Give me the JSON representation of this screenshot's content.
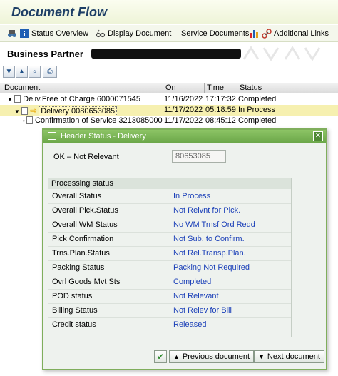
{
  "window": {
    "title": "Document Flow"
  },
  "toolbar": {
    "status_overview": "Status Overview",
    "display_document": "Display Document",
    "service_documents": "Service Documents",
    "additional_links": "Additional Links"
  },
  "business_partner": {
    "label": "Business Partner"
  },
  "grid": {
    "headers": {
      "document": "Document",
      "on": "On",
      "time": "Time",
      "status": "Status"
    },
    "rows": [
      {
        "document": "Deliv.Free of Charge 6000071545",
        "on": "11/16/2022",
        "time": "17:17:32",
        "status": "Completed"
      },
      {
        "document": "Delivery 0080653085",
        "on": "11/17/2022",
        "time": "05:18:59",
        "status": "In Process"
      },
      {
        "document": "Confirmation of Service 3213085000",
        "on": "11/17/2022",
        "time": "08:45:12",
        "status": "Completed"
      }
    ]
  },
  "dialog": {
    "title": "Header Status - Delivery",
    "ok_label": "OK – Not Relevant",
    "ok_value": "80653085",
    "processing": {
      "heading": "Processing status",
      "rows": [
        {
          "label": "Overall Status",
          "value": "In Process"
        },
        {
          "label": "Overall Pick.Status",
          "value": "Not Relvnt for Pick."
        },
        {
          "label": "Overall WM Status",
          "value": "No WM Trnsf Ord Reqd"
        },
        {
          "label": "Pick Confirmation",
          "value": "Not Sub. to Confirm."
        },
        {
          "label": "Trns.Plan.Status",
          "value": "Not Rel.Transp.Plan."
        },
        {
          "label": "Packing Status",
          "value": "Packing Not Required"
        },
        {
          "label": "Ovrl Goods Mvt Sts",
          "value": "Completed"
        },
        {
          "label": "POD status",
          "value": "Not Relevant"
        },
        {
          "label": "Billing Status",
          "value": "Not Relev for Bill"
        },
        {
          "label": "Credit status",
          "value": "Released"
        }
      ]
    },
    "buttons": {
      "previous": "Previous document",
      "next": "Next document"
    }
  },
  "colors": {
    "dialog_accent": "#6aa648",
    "value_text": "#1a3fb8",
    "selected_row": "#f6f0b0"
  }
}
